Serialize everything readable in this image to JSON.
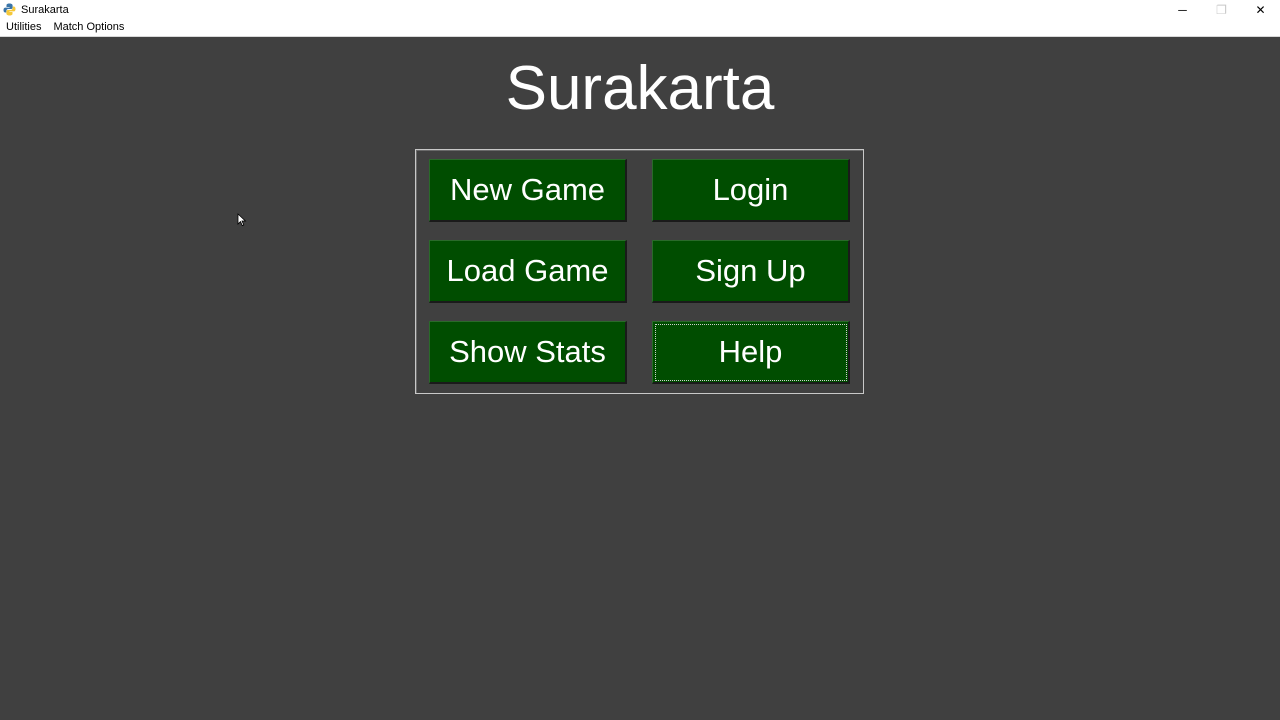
{
  "window": {
    "title": "Surakarta",
    "controls": {
      "minimize": "─",
      "maximize": "❐",
      "close": "✕"
    }
  },
  "menubar": {
    "items": [
      {
        "label": "Utilities"
      },
      {
        "label": "Match Options"
      }
    ]
  },
  "main": {
    "title": "Surakarta",
    "buttons": [
      {
        "label": "New Game"
      },
      {
        "label": "Login"
      },
      {
        "label": "Load Game"
      },
      {
        "label": "Sign Up"
      },
      {
        "label": "Show Stats"
      },
      {
        "label": "Help"
      }
    ]
  },
  "colors": {
    "background": "#404040",
    "button_green": "#004d00",
    "text": "#ffffff"
  }
}
